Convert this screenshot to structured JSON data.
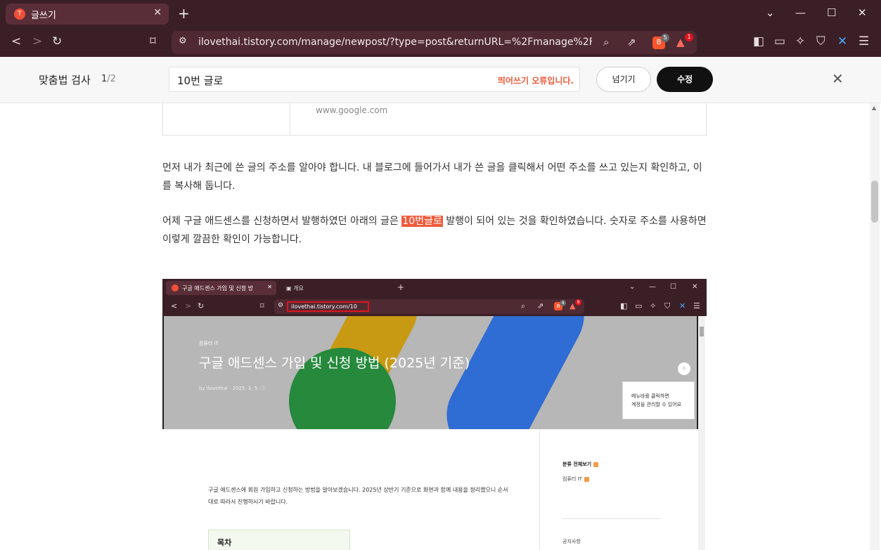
{
  "browser": {
    "tab_title": "글쓰기",
    "tab_favicon": "T",
    "url": "ilovethai.tistory.com/manage/newpost/?type=post&returnURL=%2Fmanage%2Fposts...",
    "brave_badge": "5",
    "rewards_badge": "1"
  },
  "spellcheck": {
    "title": "맞춤법 검사",
    "current": "1",
    "total": "/2",
    "input_value": "10번 글로",
    "error_text": "띄어쓰기 오류입니다.",
    "skip_label": "넘기기",
    "fix_label": "수정"
  },
  "editor": {
    "link_card_url": "www.google.com",
    "para1": "먼저 내가 최근에 쓴 글의 주소를 알아야 합니다. 내 블로그에 들어가서 내가 쓴 글을 클릭해서 어떤 주소를 쓰고 있는지 확인하고, 이를 복사해 둡니다.",
    "para2_before": "어제 구글 애드센스를 신청하면서 발행하였던 아래의 글은 ",
    "para2_highlight": "10번글로",
    "para2_after": " 발행이 되어 있는 것을 확인하였습니다. 숫자로 주소를 사용하면 이렇게 깔끔한 확인이 가능합니다."
  },
  "screenshot": {
    "tab1_title": "구글 애드센스 가입 및 신청 방",
    "tab2_title": "개요",
    "url": "ilovethai.tistory.com/10",
    "brave_badge": "4",
    "rewards_badge": "9",
    "category": "컴퓨터 IT",
    "post_title": "구글 애드센스 가입 및 신청 방법 (2025년 기준)",
    "meta": "by ilovethai · 2025. 3. 5.",
    "tooltip_line1": "메뉴바를 클릭하면",
    "tooltip_line2": "계정을 관리할 수 있어요",
    "intro": "구글 애드센스에 회원 가입하고 신청하는 방법을 알아보겠습니다. 2025년 상반기 기준으로 화면과 함께 내용을 정리했으니 순서대로 따라서 진행하시기 바랍니다.",
    "toc_label": "목차",
    "sidebar_all": "분류 전체보기",
    "sidebar_cat": "컴퓨터 IT",
    "sidebar_notice": "공지사항"
  },
  "colors": {
    "accent": "#ef5b3b",
    "chrome": "#3b1f27",
    "highlight_box": "#e0141c"
  }
}
